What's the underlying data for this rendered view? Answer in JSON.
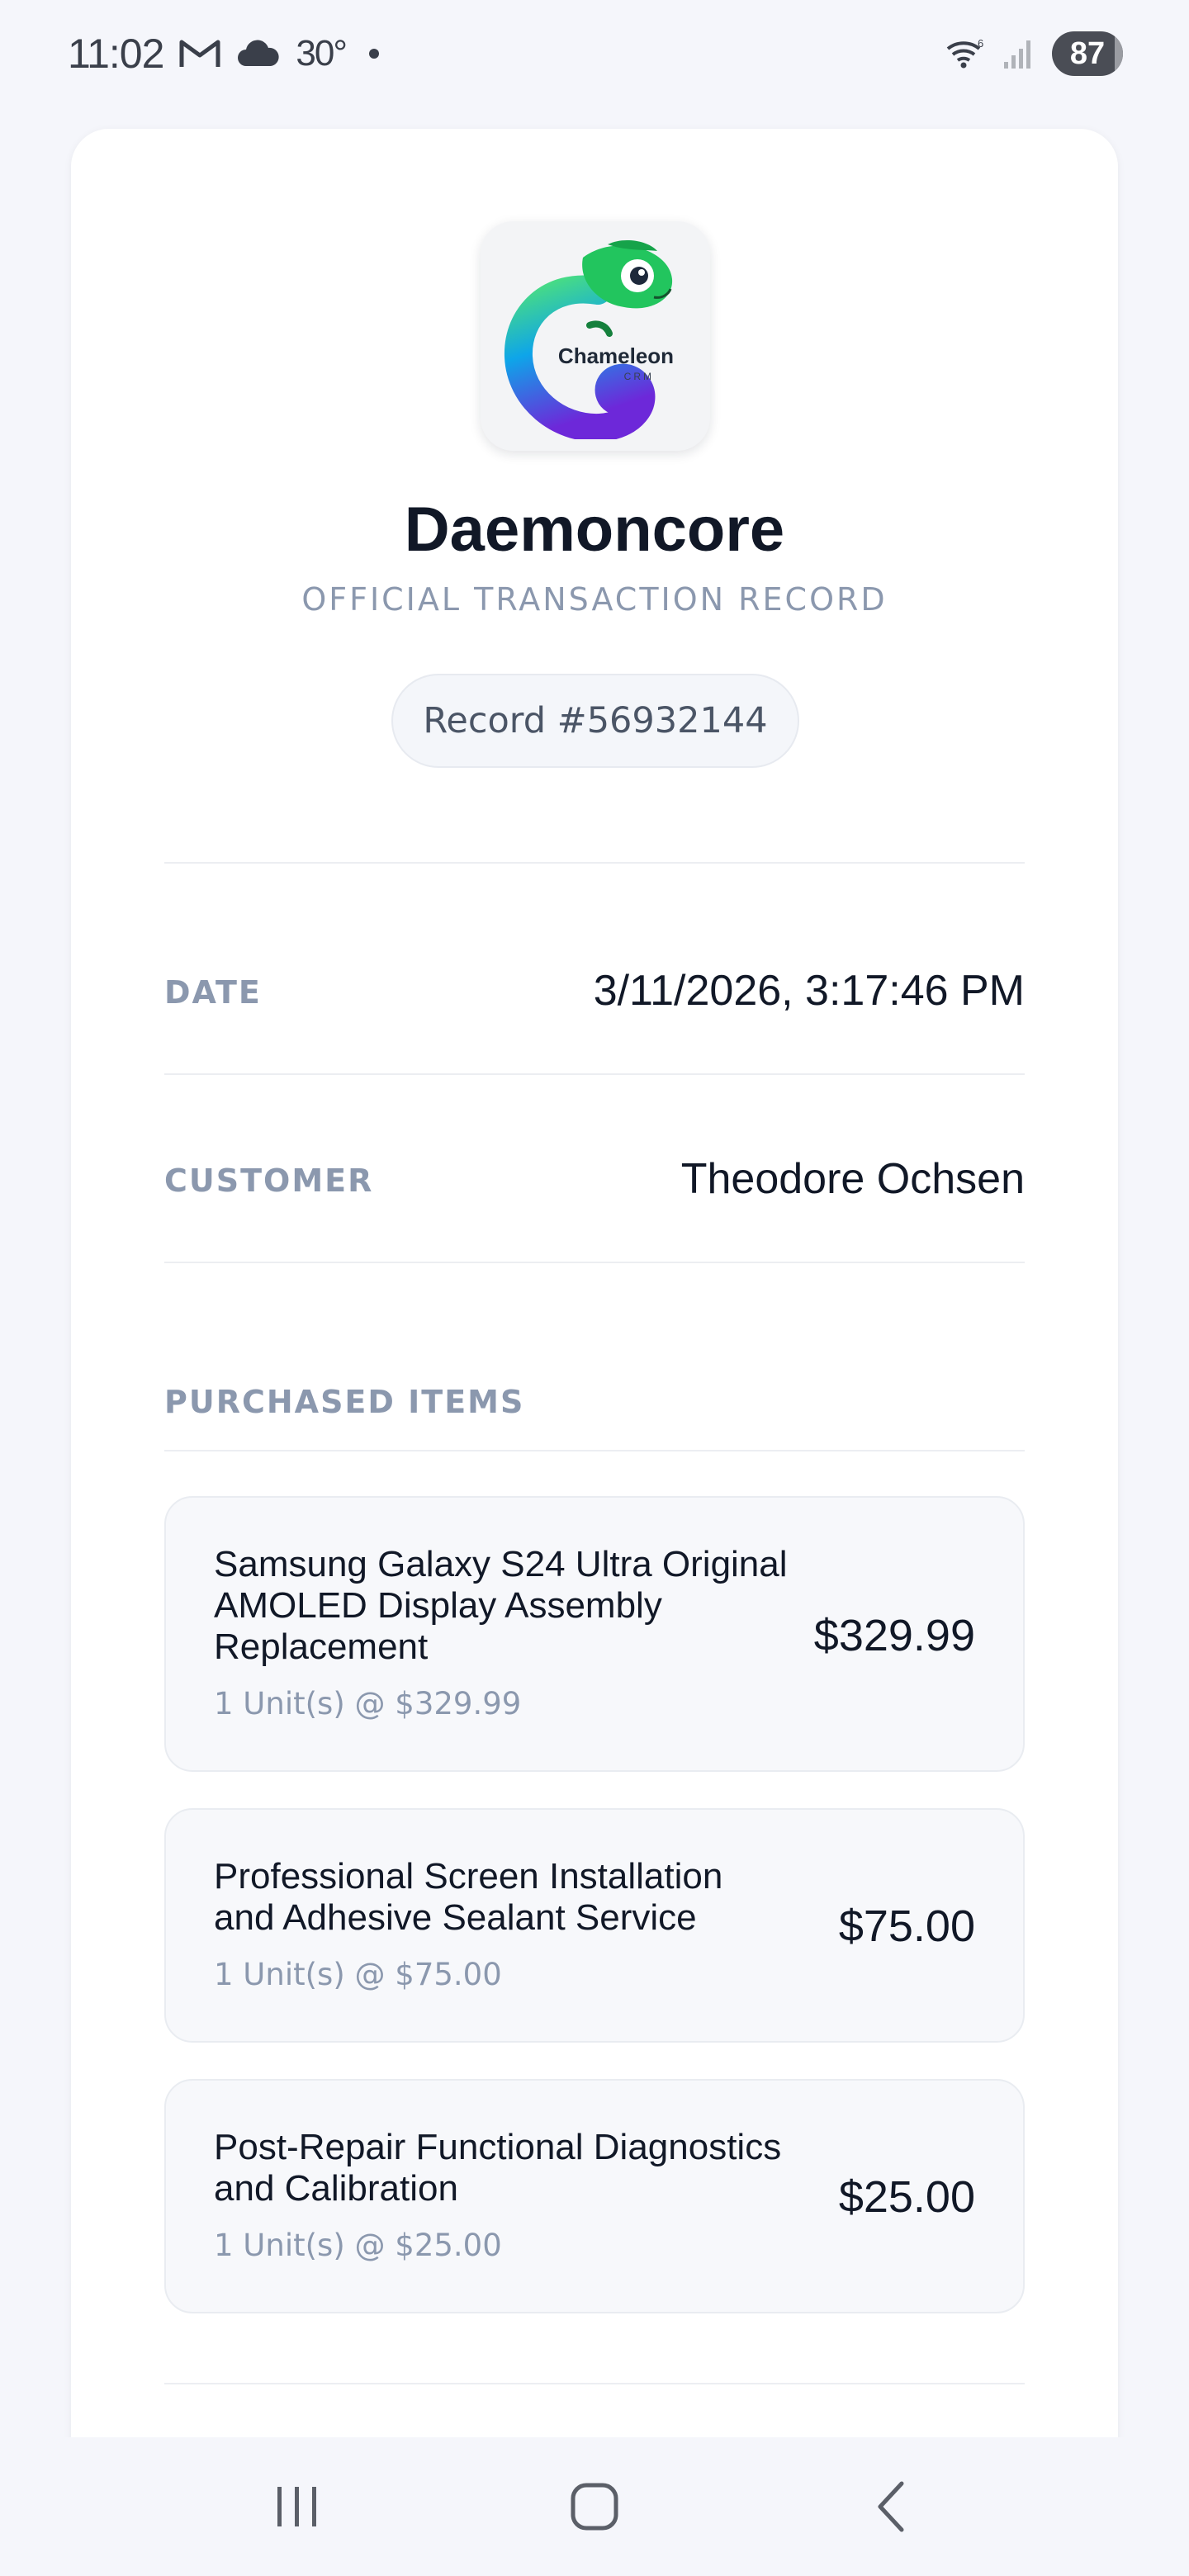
{
  "status_bar": {
    "time": "11:02",
    "temperature": "30°",
    "battery": "87",
    "icons": [
      "gmail-icon",
      "cloud-icon",
      "dot-icon",
      "wifi-icon",
      "signal-icon",
      "battery-icon"
    ]
  },
  "receipt": {
    "logo_text": "Chameleon",
    "logo_subtext": "CRM",
    "company": "Daemoncore",
    "subtitle": "OFFICIAL TRANSACTION RECORD",
    "record": "Record #56932144",
    "date_label": "DATE",
    "date_value": "3/11/2026, 3:17:46 PM",
    "customer_label": "CUSTOMER",
    "customer_value": "Theodore Ochsen",
    "items_label": "PURCHASED ITEMS",
    "items": [
      {
        "name": "Samsung Galaxy S24 Ultra Original AMOLED Display Assembly Replacement",
        "qty": "1 Unit(s) @ $329.99",
        "price": "$329.99"
      },
      {
        "name": "Professional Screen Installation and Adhesive Sealant Service",
        "qty": "1 Unit(s) @ $75.00",
        "price": "$75.00"
      },
      {
        "name": "Post-Repair Functional Diagnostics and Calibration",
        "qty": "1 Unit(s) @ $25.00",
        "price": "$25.00"
      }
    ]
  },
  "nav": {
    "icons": [
      "recent-apps-icon",
      "home-icon",
      "back-icon"
    ]
  },
  "colors": {
    "background": "#f5f6fb",
    "card": "#ffffff",
    "muted": "#8b98ae",
    "text": "#111827",
    "logo_green": "#22c55e",
    "logo_purple": "#6d28d9"
  }
}
